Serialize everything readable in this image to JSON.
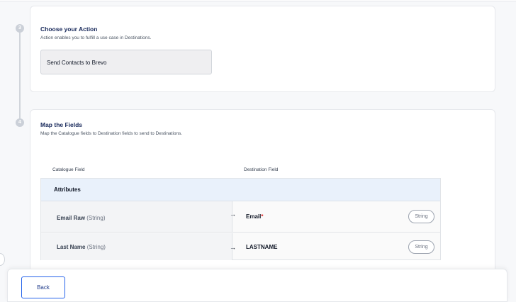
{
  "steps": {
    "action": {
      "number": "3",
      "title": "Choose your Action",
      "subtitle": "Action enables you to fulfill a use case in Destinations.",
      "selected_action": "Send Contacts to Brevo"
    },
    "mapping": {
      "number": "4",
      "title": "Map the Fields",
      "subtitle": "Map the Catalogue fields to Destination fields to send to Destinations.",
      "catalogue_header": "Catalogue Field",
      "destination_header": "Destination Field",
      "group_label": "Attributes",
      "rows": [
        {
          "source_name": "Email Raw",
          "source_type": "(String)",
          "arrow": "→",
          "destination": "Email",
          "required_mark": "*",
          "type_pill": "String"
        },
        {
          "source_name": "Last Name",
          "source_type": "(String)",
          "arrow": "→",
          "destination": "LASTNAME",
          "required_mark": "",
          "type_pill": "String"
        }
      ]
    }
  },
  "footer": {
    "back_label": "Back"
  },
  "colors": {
    "title": "#17285a",
    "attributes_bg": "#e9f1fb",
    "button_border": "#2563eb",
    "required": "#dc2626"
  }
}
